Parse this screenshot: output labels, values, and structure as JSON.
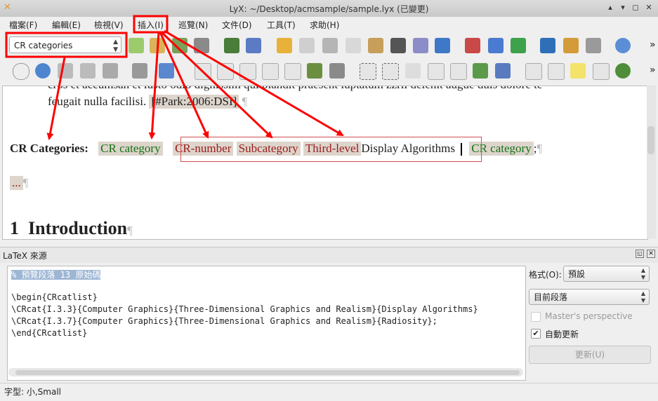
{
  "window": {
    "title": "LyX: ~/Desktop/acmsample/sample.lyx (已變更)",
    "logo": "LyX"
  },
  "menubar": {
    "items": [
      "檔案(F)",
      "編輯(E)",
      "檢視(V)",
      "插入(I)",
      "巡覽(N)",
      "文件(D)",
      "工具(T)",
      "求助(H)"
    ]
  },
  "toolbar": {
    "layout_combo": "CR categories"
  },
  "document": {
    "line1": "cros et accumsan et iusto odio dignissim qui blandit praesent luptatum zzril delenit augue duis dolore te",
    "line2": "feugait nulla facilisi.",
    "line2_cite": "[#Park:2006:DSI]",
    "pilcrow": "¶",
    "cr_label": "CR Categories:",
    "inset_cr_category_1": "CR category",
    "inset_cr_number": "CR-number",
    "inset_subcategory": "Subcategory",
    "inset_third_level": "Third-level",
    "plain_text": "Display Algorithms",
    "inset_cr_category_2": "CR category",
    "semicolon": ";",
    "ellipsis_inset": "...",
    "section_number": "1",
    "section_title": "Introduction"
  },
  "latex_panel": {
    "title": "LaTeX 來源",
    "source_lines": [
      "% 預覽段落 13 原始碼",
      "",
      "\\begin{CRcatlist}",
      "\\CRcat{I.3.3}{Computer Graphics}{Three-Dimensional Graphics and Realism}{Display Algorithms}",
      "\\CRcat{I.3.7}{Computer Graphics}{Three-Dimensional Graphics and Realism}{Radiosity};",
      "\\end{CRcatlist}"
    ],
    "format_label": "格式(O):",
    "format_value": "預設",
    "scope_value": "目前段落",
    "masters_perspective": "Master's perspective",
    "auto_update": "自動更新",
    "update_button": "更新(U)"
  },
  "statusbar": {
    "text": "字型: 小,Small"
  },
  "colors": {
    "annotation": "#ff0000",
    "inset_bg": "#ddd5cc",
    "green_inset": "#157015",
    "red_inset": "#9a1a1a"
  }
}
